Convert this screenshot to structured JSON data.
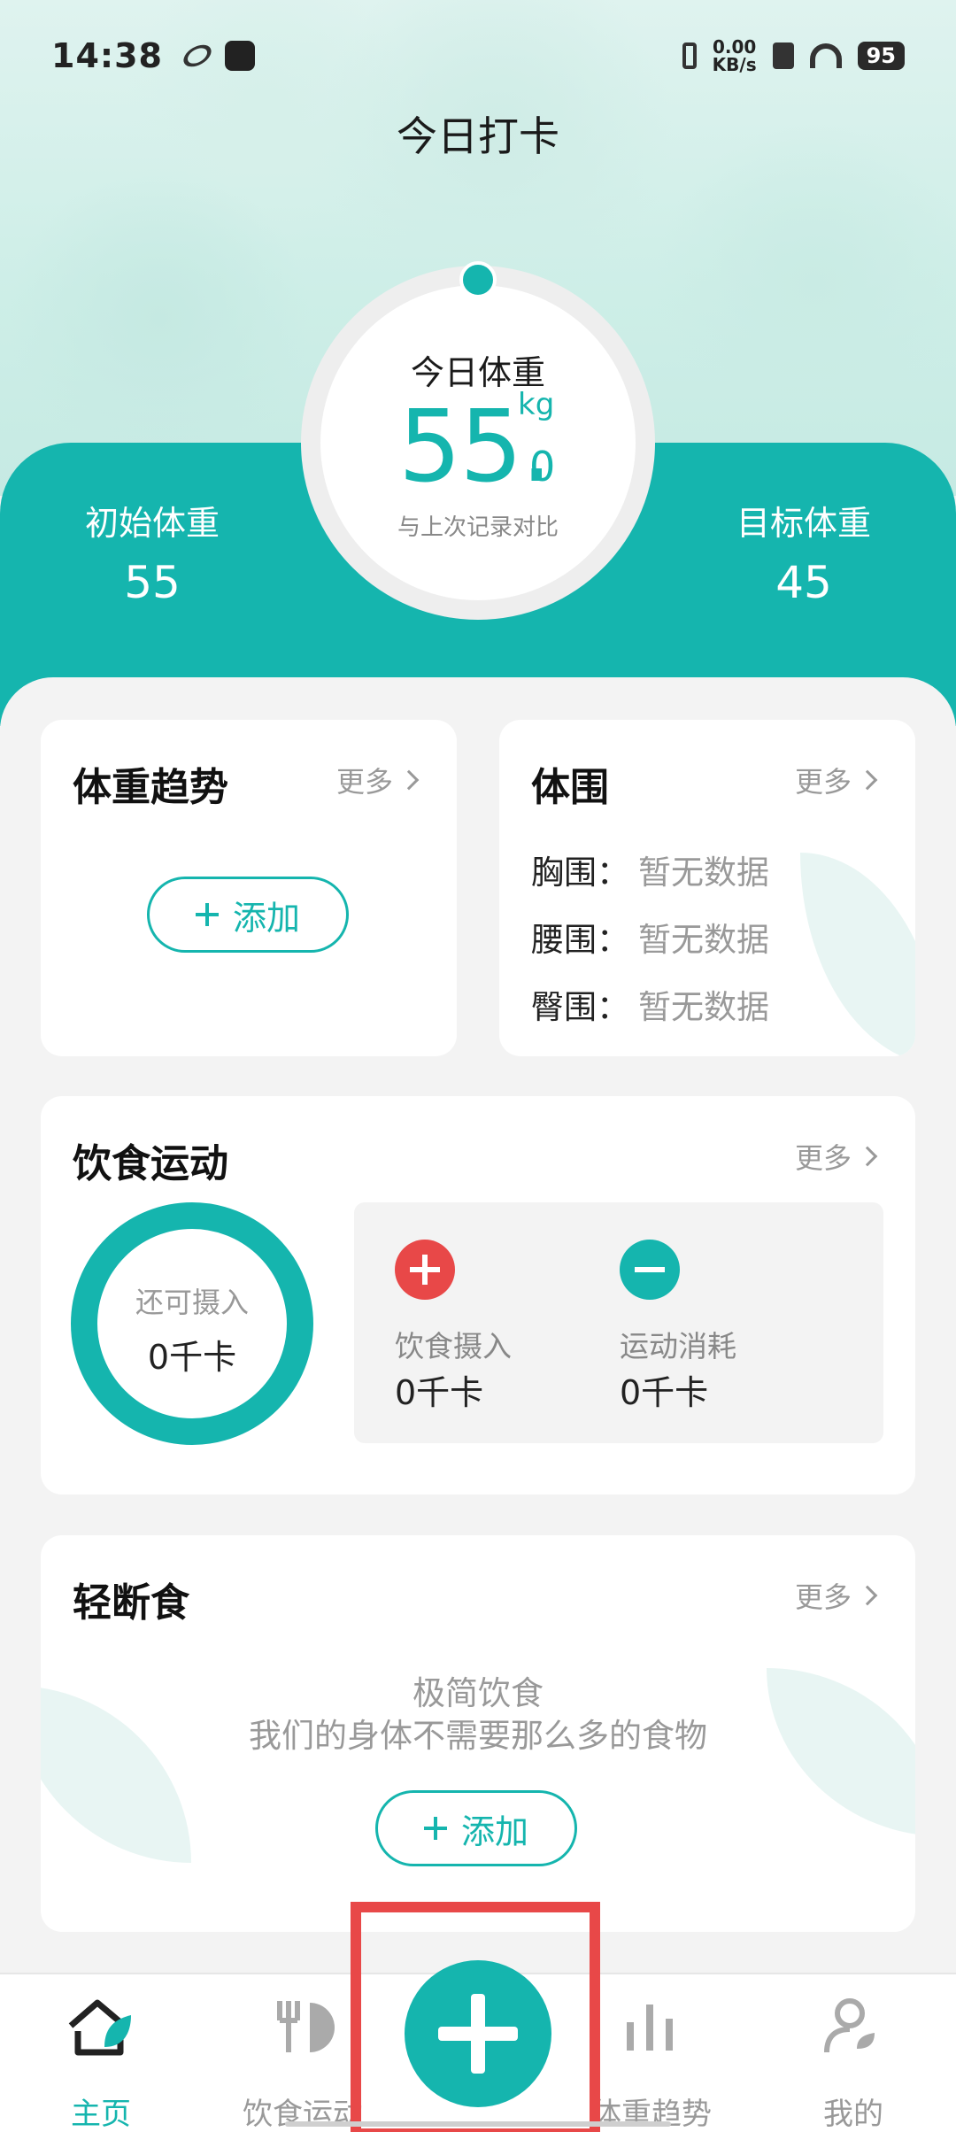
{
  "status_bar": {
    "time": "14:38",
    "net_speed_value": "0.00",
    "net_speed_unit": "KB/s",
    "battery": "95"
  },
  "header": {
    "title": "今日打卡"
  },
  "weight": {
    "today_label": "今日体重",
    "value_int": "55.",
    "value_decimal": "0",
    "unit": "kg",
    "compare_label": "与上次记录对比",
    "initial_label": "初始体重",
    "initial_value": "55",
    "target_label": "目标体重",
    "target_value": "45"
  },
  "trend_card": {
    "title": "体重趋势",
    "more": "更多",
    "add_label": "添加"
  },
  "girth_card": {
    "title": "体围",
    "more": "更多",
    "rows": [
      {
        "label": "胸围：",
        "value": "暂无数据"
      },
      {
        "label": "腰围：",
        "value": "暂无数据"
      },
      {
        "label": "臀围：",
        "value": "暂无数据"
      }
    ]
  },
  "diet_card": {
    "title": "饮食运动",
    "more": "更多",
    "remaining_label": "还可摄入",
    "remaining_value": "0千卡",
    "intake_label": "饮食摄入",
    "intake_value": "0千卡",
    "burn_label": "运动消耗",
    "burn_value": "0千卡"
  },
  "fasting_card": {
    "title": "轻断食",
    "more": "更多",
    "line1": "极简饮食",
    "line2": "我们的身体不需要那么多的食物",
    "add_label": "添加"
  },
  "bottom_nav": {
    "items": [
      {
        "label": "主页",
        "icon": "home-icon",
        "active": true
      },
      {
        "label": "饮食运动",
        "icon": "fork-knife-icon"
      },
      {
        "label": "体重趋势",
        "icon": "bar-chart-icon"
      },
      {
        "label": "我的",
        "icon": "profile-icon"
      }
    ]
  },
  "colors": {
    "accent": "#15b5ae",
    "red": "#e84848",
    "muted": "#999999"
  }
}
